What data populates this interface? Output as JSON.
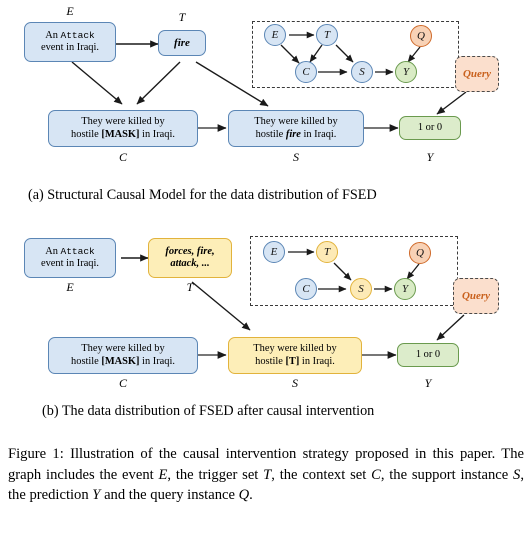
{
  "figure": {
    "subfigure_a": {
      "label": "(a)",
      "caption": "Structural Causal Model for the data distribution of FSED",
      "boxes": {
        "event": {
          "line1_prefix": "An ",
          "line1_mono": "Attack",
          "line2": "event in Iraqi.",
          "label": "E",
          "color": "blue"
        },
        "trigger": {
          "text": "fire",
          "label": "T",
          "color": "blue"
        },
        "context": {
          "line1": "They were killed by",
          "line2_pre": "hostile ",
          "line2_bold": "[MASK]",
          "line2_post": " in Iraqi.",
          "label": "C",
          "color": "blue"
        },
        "support": {
          "line1": "They were killed by",
          "line2_pre": "hostile ",
          "line2_em": "fire",
          "line2_post": " in Iraqi.",
          "label": "S",
          "color": "blue"
        },
        "prediction": {
          "text": "1 or 0",
          "label": "Y",
          "color": "green"
        },
        "query": {
          "text": "Query",
          "color": "query"
        }
      },
      "graph": {
        "nodes": [
          {
            "id": "E",
            "label": "E",
            "color": "blue"
          },
          {
            "id": "T",
            "label": "T",
            "color": "blue"
          },
          {
            "id": "C",
            "label": "C",
            "color": "blue"
          },
          {
            "id": "S",
            "label": "S",
            "color": "blue"
          },
          {
            "id": "Y",
            "label": "Y",
            "color": "green"
          },
          {
            "id": "Q",
            "label": "Q",
            "color": "orange"
          }
        ],
        "edges": [
          {
            "from": "E",
            "to": "T"
          },
          {
            "from": "E",
            "to": "C"
          },
          {
            "from": "T",
            "to": "C"
          },
          {
            "from": "T",
            "to": "S"
          },
          {
            "from": "C",
            "to": "S"
          },
          {
            "from": "S",
            "to": "Y"
          },
          {
            "from": "Q",
            "to": "Y"
          }
        ]
      }
    },
    "subfigure_b": {
      "label": "(b)",
      "caption": "The data distribution of FSED after causal intervention",
      "boxes": {
        "event": {
          "line1_prefix": "An ",
          "line1_mono": "Attack",
          "line2": "event in Iraqi.",
          "label": "E",
          "color": "blue"
        },
        "trigger": {
          "line1": "forces, fire,",
          "line2": "attack, ...",
          "label": "T",
          "color": "yellow"
        },
        "context": {
          "line1": "They were killed by",
          "line2_pre": "hostile ",
          "line2_bold": "[MASK]",
          "line2_post": " in Iraqi.",
          "label": "C",
          "color": "blue"
        },
        "support": {
          "line1": "They were killed by",
          "line2_pre": "hostile ",
          "line2_bold": "[T]",
          "line2_post": " in Iraqi.",
          "label": "S",
          "color": "yellow"
        },
        "prediction": {
          "text": "1 or 0",
          "label": "Y",
          "color": "green"
        },
        "query": {
          "text": "Query",
          "color": "query"
        }
      },
      "graph": {
        "nodes": [
          {
            "id": "E",
            "label": "E",
            "color": "blue"
          },
          {
            "id": "T",
            "label": "T",
            "color": "yellow"
          },
          {
            "id": "C",
            "label": "C",
            "color": "blue"
          },
          {
            "id": "S",
            "label": "S",
            "color": "yellow"
          },
          {
            "id": "Y",
            "label": "Y",
            "color": "green"
          },
          {
            "id": "Q",
            "label": "Q",
            "color": "orange"
          }
        ],
        "edges": [
          {
            "from": "E",
            "to": "T"
          },
          {
            "from": "T",
            "to": "S"
          },
          {
            "from": "C",
            "to": "S"
          },
          {
            "from": "S",
            "to": "Y"
          },
          {
            "from": "Q",
            "to": "Y"
          }
        ]
      }
    },
    "main_caption": {
      "prefix": "Figure 1:",
      "text": "Illustration of the causal intervention strategy proposed in this paper. The graph includes the event E, the trigger set T, the context set C, the support instance S, the prediction Y and the query instance Q."
    },
    "colors": {
      "blue_fill": "#d7e5f4",
      "blue_stroke": "#5b86b5",
      "yellow_fill": "#fdeeb8",
      "yellow_stroke": "#e2b33c",
      "green_fill": "#dceccb",
      "green_stroke": "#6a9a4e",
      "orange_fill": "#f8d2b6",
      "orange_stroke": "#cf6a2a",
      "query_fill": "#fbdfcd",
      "query_text": "#c9611d",
      "arrow": "#1a1a1a"
    }
  }
}
